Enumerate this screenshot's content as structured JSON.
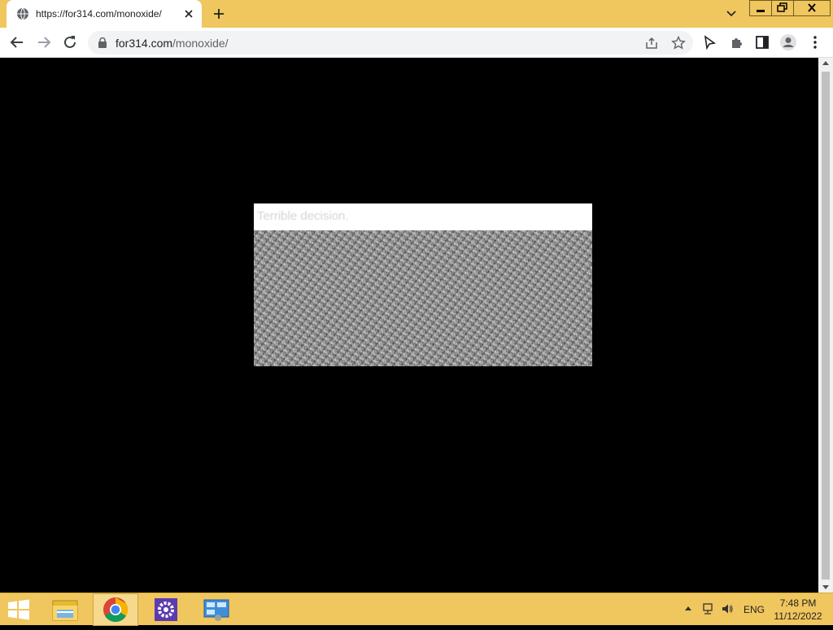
{
  "browser": {
    "tab": {
      "title": "https://for314.com/monoxide/",
      "icon": "globe-icon"
    },
    "address": {
      "domain": "for314.com",
      "path": "/monoxide/"
    }
  },
  "page": {
    "popup": {
      "title": "Terrible decision."
    }
  },
  "taskbar": {
    "language": "ENG",
    "time": "7:48 PM",
    "date": "11/12/2022"
  },
  "colors": {
    "titlebar": "#f0c65e",
    "taskbar": "#f0c65e",
    "page_background": "#000000"
  }
}
